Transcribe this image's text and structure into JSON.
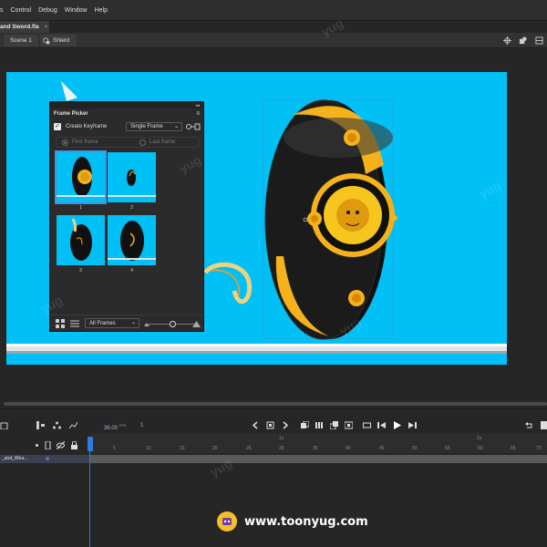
{
  "menu": [
    "s",
    "Control",
    "Debug",
    "Window",
    "Help"
  ],
  "document_tab": {
    "label": "and Sword.fla",
    "close": "×"
  },
  "editbar": {
    "scene": "Scene 1",
    "symbol": "Shield"
  },
  "frame_picker": {
    "title": "Frame Picker",
    "collapse": "◂◂",
    "menu_icon": "≡",
    "create_keyframe_checked": "✓",
    "create_keyframe_label": "Create Keyframe",
    "mode": "Single Frame",
    "first_frame": "First frame",
    "last_frame": "Last frame",
    "thumbnails": [
      {
        "label": "1",
        "selected": true
      },
      {
        "label": "2",
        "selected": false
      },
      {
        "label": "3",
        "selected": false
      },
      {
        "label": "4",
        "selected": false
      }
    ],
    "filter": "All Frames",
    "zoom_level": 0.55
  },
  "timeline": {
    "fps": "36.00",
    "fps_unit": "FPS",
    "current_frame": "1",
    "ruler_ticks": [
      "1",
      "5",
      "10",
      "15",
      "20",
      "25",
      "30",
      "35",
      "40",
      "45",
      "50",
      "55",
      "60",
      "65",
      "70"
    ],
    "seconds": [
      "1s",
      "2s"
    ],
    "layer_name": "_and_Wea..."
  },
  "watermark": "yug",
  "site": "www.toonyug.com",
  "colors": {
    "stage": "#00c0f6",
    "ui_dark": "#262626",
    "accent": "#2f7ce0",
    "shield_gold": "#f6b21a"
  }
}
